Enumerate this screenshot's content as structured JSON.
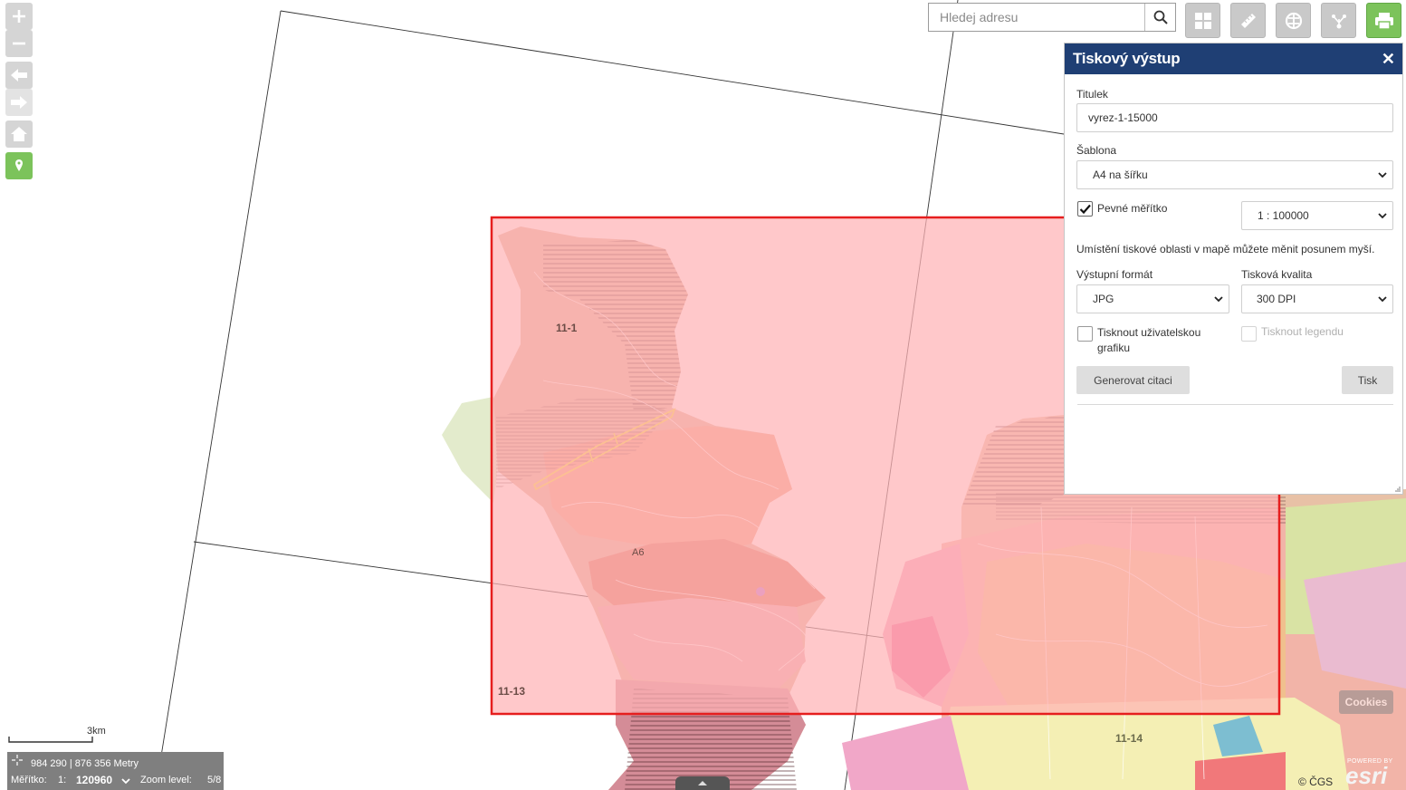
{
  "search": {
    "placeholder": "Hledej adresu"
  },
  "toolbar": {
    "buttons": [
      {
        "name": "basemap-gallery-button",
        "icon": "grid-icon"
      },
      {
        "name": "measure-button",
        "icon": "ruler-icon"
      },
      {
        "name": "layers-button",
        "icon": "layers-icon"
      },
      {
        "name": "share-button",
        "icon": "share-icon"
      },
      {
        "name": "print-button",
        "icon": "printer-icon",
        "active": true
      }
    ]
  },
  "map_controls": [
    "zoom-in-icon",
    "zoom-out-icon",
    "back-arrow-icon",
    "forward-arrow-icon",
    "home-icon",
    "locate-icon"
  ],
  "print_panel": {
    "title": "Tiskový výstup",
    "close": "✕",
    "title_label": "Titulek",
    "title_value": "vyrez-1-15000",
    "template_label": "Šablona",
    "template_value": "A4 na šířku",
    "fixed_scale_label": "Pevné měřítko",
    "fixed_scale_checked": true,
    "scale_value": "1 : 100000",
    "hint": "Umístění tiskové oblasti v mapě můžete měnit posunem myší.",
    "format_label": "Výstupní formát",
    "format_value": "JPG",
    "quality_label": "Tisková kvalita",
    "quality_value": "300 DPI",
    "user_graphics_label_1": "Tisknout uživatelskou",
    "user_graphics_label_2": "grafiku",
    "legend_label": "Tisknout legendu",
    "cite_button": "Generovat citaci",
    "print_button": "Tisk"
  },
  "map_labels": {
    "sheet_11_1": "11-1",
    "sheet_11_13": "11-13",
    "sheet_11_14": "11-14",
    "area_a": "A6"
  },
  "scale_bar": "3km",
  "status": {
    "coords": "984 290 | 876 356 Metry",
    "scale_label": "Měřítko:",
    "scale_prefix": "1:",
    "scale_value": "120960",
    "zoom_label": "Zoom level:",
    "zoom_value": "5/8"
  },
  "attribution": "© ČGS",
  "cookies": "Cookies",
  "esri_powered": "POWERED BY",
  "esri_logo": "esri",
  "colors": {
    "header": "#1f3f74",
    "active_tool": "#7cc35b",
    "print_area_fill": "#ffb3b5",
    "print_area_border": "#e61e1e"
  }
}
